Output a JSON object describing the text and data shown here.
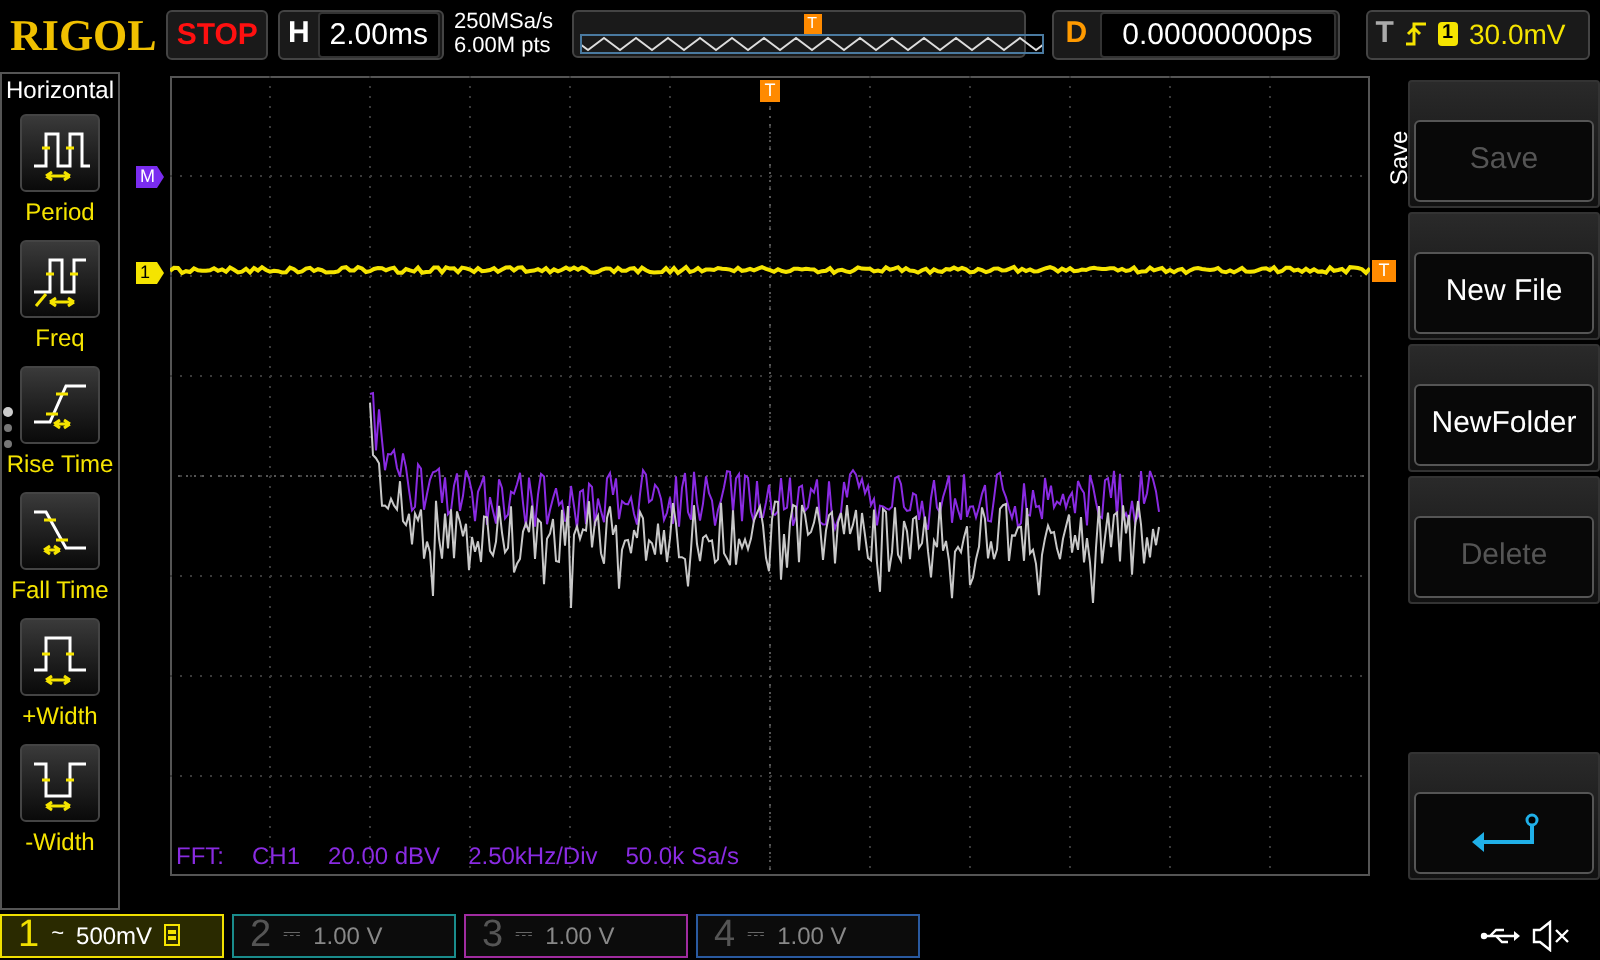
{
  "top_bar": {
    "logo": "RIGOL",
    "run_status": "STOP",
    "horizontal": {
      "label": "H",
      "value": "2.00ms"
    },
    "sample_rate": "250MSa/s",
    "memory_depth": "6.00M pts",
    "trigger_position": "T",
    "delay": {
      "label": "D",
      "value": "0.00000000ps"
    },
    "trigger": {
      "label": "T",
      "source": "1",
      "level": "30.0mV"
    }
  },
  "measure_panel": {
    "title": "Horizontal",
    "items": [
      {
        "kind": "period",
        "label": "Period"
      },
      {
        "kind": "freq",
        "label": "Freq"
      },
      {
        "kind": "rise",
        "label": "Rise Time"
      },
      {
        "kind": "fall",
        "label": "Fall Time"
      },
      {
        "kind": "pos_width",
        "label": "+Width"
      },
      {
        "kind": "neg_width",
        "label": "-Width"
      }
    ]
  },
  "display": {
    "markers": [
      {
        "kind": "trigger_top",
        "label": "T"
      },
      {
        "kind": "math",
        "label": "M"
      },
      {
        "kind": "channel",
        "label": "1"
      },
      {
        "kind": "trigger",
        "label": "T"
      }
    ],
    "fft_info": [
      "FFT:",
      "CH1",
      "20.00 dBV",
      "2.50kHz/Div",
      "50.0k Sa/s"
    ]
  },
  "menu": {
    "title": "Save",
    "items": [
      {
        "kind": "button",
        "label": "Save",
        "disabled": true
      },
      {
        "kind": "button",
        "label": "New File",
        "disabled": false
      },
      {
        "kind": "button",
        "label": "NewFolder",
        "disabled": false
      },
      {
        "kind": "button",
        "label": "Delete",
        "disabled": true
      },
      {
        "kind": "back"
      }
    ]
  },
  "channels": [
    {
      "number": "1",
      "coupling": "~",
      "scale": "500mV",
      "on": true,
      "color": "#f0e000"
    },
    {
      "number": "2",
      "coupling": "⎓",
      "scale": "1.00 V",
      "on": false,
      "color": "#1a8c8c"
    },
    {
      "number": "3",
      "coupling": "⎓",
      "scale": "1.00 V",
      "on": false,
      "color": "#a02ca0"
    },
    {
      "number": "4",
      "coupling": "⎓",
      "scale": "1.00 V",
      "on": false,
      "color": "#2a5aa0"
    }
  ]
}
